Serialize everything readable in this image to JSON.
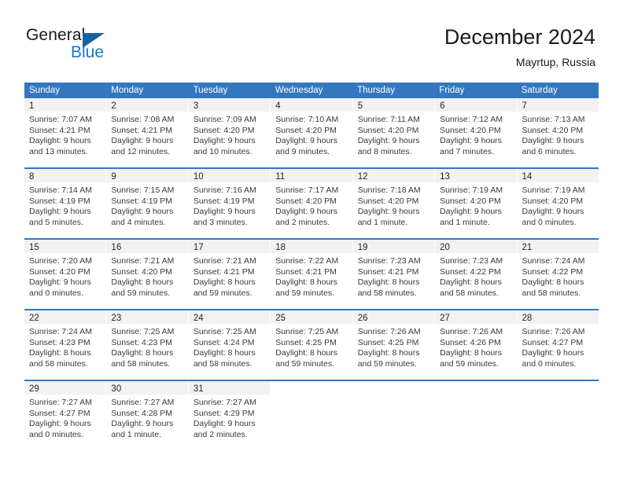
{
  "brand": {
    "word_general": "General",
    "word_blue": "Blue",
    "triangle_icon": "triangle-icon",
    "accent_color": "#1a76c8",
    "triangle_color": "#1464a5"
  },
  "header": {
    "title": "December 2024",
    "subtitle": "Mayrtup, Russia"
  },
  "calendar": {
    "header_bg": "#3577bf",
    "daycell_bg": "#f2f2f2",
    "weekdays": [
      "Sunday",
      "Monday",
      "Tuesday",
      "Wednesday",
      "Thursday",
      "Friday",
      "Saturday"
    ],
    "weeks": [
      [
        {
          "day": "1",
          "sunrise": "Sunrise: 7:07 AM",
          "sunset": "Sunset: 4:21 PM",
          "daylight1": "Daylight: 9 hours",
          "daylight2": "and 13 minutes."
        },
        {
          "day": "2",
          "sunrise": "Sunrise: 7:08 AM",
          "sunset": "Sunset: 4:21 PM",
          "daylight1": "Daylight: 9 hours",
          "daylight2": "and 12 minutes."
        },
        {
          "day": "3",
          "sunrise": "Sunrise: 7:09 AM",
          "sunset": "Sunset: 4:20 PM",
          "daylight1": "Daylight: 9 hours",
          "daylight2": "and 10 minutes."
        },
        {
          "day": "4",
          "sunrise": "Sunrise: 7:10 AM",
          "sunset": "Sunset: 4:20 PM",
          "daylight1": "Daylight: 9 hours",
          "daylight2": "and 9 minutes."
        },
        {
          "day": "5",
          "sunrise": "Sunrise: 7:11 AM",
          "sunset": "Sunset: 4:20 PM",
          "daylight1": "Daylight: 9 hours",
          "daylight2": "and 8 minutes."
        },
        {
          "day": "6",
          "sunrise": "Sunrise: 7:12 AM",
          "sunset": "Sunset: 4:20 PM",
          "daylight1": "Daylight: 9 hours",
          "daylight2": "and 7 minutes."
        },
        {
          "day": "7",
          "sunrise": "Sunrise: 7:13 AM",
          "sunset": "Sunset: 4:20 PM",
          "daylight1": "Daylight: 9 hours",
          "daylight2": "and 6 minutes."
        }
      ],
      [
        {
          "day": "8",
          "sunrise": "Sunrise: 7:14 AM",
          "sunset": "Sunset: 4:19 PM",
          "daylight1": "Daylight: 9 hours",
          "daylight2": "and 5 minutes."
        },
        {
          "day": "9",
          "sunrise": "Sunrise: 7:15 AM",
          "sunset": "Sunset: 4:19 PM",
          "daylight1": "Daylight: 9 hours",
          "daylight2": "and 4 minutes."
        },
        {
          "day": "10",
          "sunrise": "Sunrise: 7:16 AM",
          "sunset": "Sunset: 4:19 PM",
          "daylight1": "Daylight: 9 hours",
          "daylight2": "and 3 minutes."
        },
        {
          "day": "11",
          "sunrise": "Sunrise: 7:17 AM",
          "sunset": "Sunset: 4:20 PM",
          "daylight1": "Daylight: 9 hours",
          "daylight2": "and 2 minutes."
        },
        {
          "day": "12",
          "sunrise": "Sunrise: 7:18 AM",
          "sunset": "Sunset: 4:20 PM",
          "daylight1": "Daylight: 9 hours",
          "daylight2": "and 1 minute."
        },
        {
          "day": "13",
          "sunrise": "Sunrise: 7:19 AM",
          "sunset": "Sunset: 4:20 PM",
          "daylight1": "Daylight: 9 hours",
          "daylight2": "and 1 minute."
        },
        {
          "day": "14",
          "sunrise": "Sunrise: 7:19 AM",
          "sunset": "Sunset: 4:20 PM",
          "daylight1": "Daylight: 9 hours",
          "daylight2": "and 0 minutes."
        }
      ],
      [
        {
          "day": "15",
          "sunrise": "Sunrise: 7:20 AM",
          "sunset": "Sunset: 4:20 PM",
          "daylight1": "Daylight: 9 hours",
          "daylight2": "and 0 minutes."
        },
        {
          "day": "16",
          "sunrise": "Sunrise: 7:21 AM",
          "sunset": "Sunset: 4:20 PM",
          "daylight1": "Daylight: 8 hours",
          "daylight2": "and 59 minutes."
        },
        {
          "day": "17",
          "sunrise": "Sunrise: 7:21 AM",
          "sunset": "Sunset: 4:21 PM",
          "daylight1": "Daylight: 8 hours",
          "daylight2": "and 59 minutes."
        },
        {
          "day": "18",
          "sunrise": "Sunrise: 7:22 AM",
          "sunset": "Sunset: 4:21 PM",
          "daylight1": "Daylight: 8 hours",
          "daylight2": "and 59 minutes."
        },
        {
          "day": "19",
          "sunrise": "Sunrise: 7:23 AM",
          "sunset": "Sunset: 4:21 PM",
          "daylight1": "Daylight: 8 hours",
          "daylight2": "and 58 minutes."
        },
        {
          "day": "20",
          "sunrise": "Sunrise: 7:23 AM",
          "sunset": "Sunset: 4:22 PM",
          "daylight1": "Daylight: 8 hours",
          "daylight2": "and 58 minutes."
        },
        {
          "day": "21",
          "sunrise": "Sunrise: 7:24 AM",
          "sunset": "Sunset: 4:22 PM",
          "daylight1": "Daylight: 8 hours",
          "daylight2": "and 58 minutes."
        }
      ],
      [
        {
          "day": "22",
          "sunrise": "Sunrise: 7:24 AM",
          "sunset": "Sunset: 4:23 PM",
          "daylight1": "Daylight: 8 hours",
          "daylight2": "and 58 minutes."
        },
        {
          "day": "23",
          "sunrise": "Sunrise: 7:25 AM",
          "sunset": "Sunset: 4:23 PM",
          "daylight1": "Daylight: 8 hours",
          "daylight2": "and 58 minutes."
        },
        {
          "day": "24",
          "sunrise": "Sunrise: 7:25 AM",
          "sunset": "Sunset: 4:24 PM",
          "daylight1": "Daylight: 8 hours",
          "daylight2": "and 58 minutes."
        },
        {
          "day": "25",
          "sunrise": "Sunrise: 7:25 AM",
          "sunset": "Sunset: 4:25 PM",
          "daylight1": "Daylight: 8 hours",
          "daylight2": "and 59 minutes."
        },
        {
          "day": "26",
          "sunrise": "Sunrise: 7:26 AM",
          "sunset": "Sunset: 4:25 PM",
          "daylight1": "Daylight: 8 hours",
          "daylight2": "and 59 minutes."
        },
        {
          "day": "27",
          "sunrise": "Sunrise: 7:26 AM",
          "sunset": "Sunset: 4:26 PM",
          "daylight1": "Daylight: 8 hours",
          "daylight2": "and 59 minutes."
        },
        {
          "day": "28",
          "sunrise": "Sunrise: 7:26 AM",
          "sunset": "Sunset: 4:27 PM",
          "daylight1": "Daylight: 9 hours",
          "daylight2": "and 0 minutes."
        }
      ],
      [
        {
          "day": "29",
          "sunrise": "Sunrise: 7:27 AM",
          "sunset": "Sunset: 4:27 PM",
          "daylight1": "Daylight: 9 hours",
          "daylight2": "and 0 minutes."
        },
        {
          "day": "30",
          "sunrise": "Sunrise: 7:27 AM",
          "sunset": "Sunset: 4:28 PM",
          "daylight1": "Daylight: 9 hours",
          "daylight2": "and 1 minute."
        },
        {
          "day": "31",
          "sunrise": "Sunrise: 7:27 AM",
          "sunset": "Sunset: 4:29 PM",
          "daylight1": "Daylight: 9 hours",
          "daylight2": "and 2 minutes."
        },
        {
          "day": "",
          "sunrise": "",
          "sunset": "",
          "daylight1": "",
          "daylight2": ""
        },
        {
          "day": "",
          "sunrise": "",
          "sunset": "",
          "daylight1": "",
          "daylight2": ""
        },
        {
          "day": "",
          "sunrise": "",
          "sunset": "",
          "daylight1": "",
          "daylight2": ""
        },
        {
          "day": "",
          "sunrise": "",
          "sunset": "",
          "daylight1": "",
          "daylight2": ""
        }
      ]
    ]
  }
}
